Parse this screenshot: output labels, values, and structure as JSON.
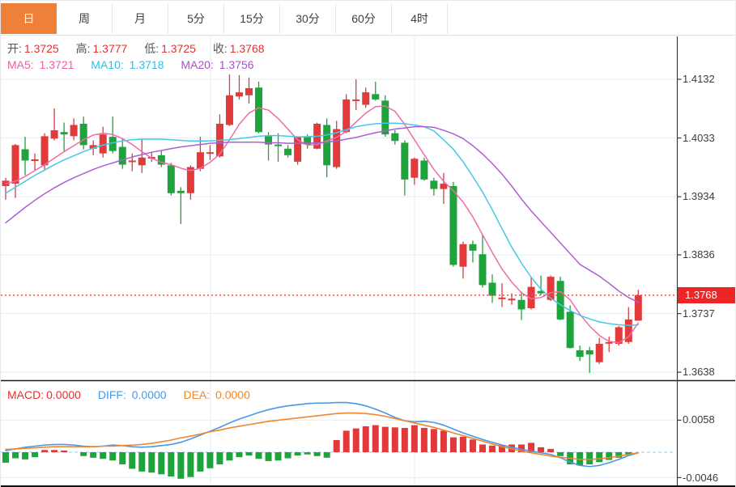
{
  "toolbar": {
    "tabs": [
      {
        "label": "日",
        "active": true
      },
      {
        "label": "周",
        "active": false
      },
      {
        "label": "月",
        "active": false
      },
      {
        "label": "5分",
        "active": false
      },
      {
        "label": "15分",
        "active": false
      },
      {
        "label": "30分",
        "active": false
      },
      {
        "label": "60分",
        "active": false
      },
      {
        "label": "4时",
        "active": false
      }
    ]
  },
  "legend": {
    "ohlc": [
      {
        "label": "开:",
        "value": "1.3725"
      },
      {
        "label": "高:",
        "value": "1.3777"
      },
      {
        "label": "低:",
        "value": "1.3725"
      },
      {
        "label": "收:",
        "value": "1.3768"
      }
    ],
    "ma": [
      {
        "label": "MA5:",
        "value": "1.3721"
      },
      {
        "label": "MA10:",
        "value": "1.3718"
      },
      {
        "label": "MA20:",
        "value": "1.3756"
      }
    ]
  },
  "macd_legend": [
    {
      "label": "MACD:",
      "value": "0.0000"
    },
    {
      "label": "DIFF:",
      "value": "0.0000"
    },
    {
      "label": "DEA:",
      "value": "0.0000"
    }
  ],
  "y_axis": {
    "ticks": [
      "1.4132",
      "1.4033",
      "1.3934",
      "1.3836",
      "1.3737",
      "1.3638"
    ],
    "current_price": "1.3768"
  },
  "macd_axis": {
    "ticks": [
      "0.0058",
      "-0.0046"
    ]
  },
  "colors": {
    "up": "#e23a3a",
    "down": "#1fa33c",
    "ma5": "#f06ca8",
    "ma10": "#45c8e9",
    "ma20": "#ad5fd5",
    "diff": "#4a97e8",
    "dea": "#f0862e",
    "price_line": "#f34b4b",
    "badge_bg": "#ef2525",
    "tab_active": "#ee8038",
    "grid": "#e4edf4",
    "zero_line": "#aad4f2",
    "axis_line": "#3a3a3a"
  },
  "chart_data": {
    "type": "candlestick",
    "title": "",
    "xlabel": "",
    "ylabel": "",
    "price_panel": {
      "y_ticks": [
        1.4132,
        1.4033,
        1.3934,
        1.3836,
        1.3737,
        1.3638
      ],
      "ylim": [
        1.36,
        1.418
      ],
      "current_price": 1.3768,
      "ohlc_latest": {
        "open": 1.3725,
        "high": 1.3777,
        "low": 1.3725,
        "close": 1.3768
      },
      "candles_ohlc": [
        [
          1.3952,
          1.3966,
          1.3929,
          1.3961
        ],
        [
          1.3956,
          1.4023,
          1.3932,
          1.4021
        ],
        [
          1.4014,
          1.4035,
          1.397,
          1.3995
        ],
        [
          1.3996,
          1.4007,
          1.3977,
          1.3997
        ],
        [
          1.3987,
          1.4041,
          1.398,
          1.4036
        ],
        [
          1.4032,
          1.4083,
          1.4029,
          1.4046
        ],
        [
          1.4043,
          1.4059,
          1.4011,
          1.4039
        ],
        [
          1.4036,
          1.4066,
          1.4029,
          1.4055
        ],
        [
          1.4057,
          1.4069,
          1.4014,
          1.4021
        ],
        [
          1.4015,
          1.4029,
          1.4004,
          1.4021
        ],
        [
          1.4007,
          1.4052,
          1.4,
          1.4039
        ],
        [
          1.4035,
          1.4069,
          1.4007,
          1.4011
        ],
        [
          1.4018,
          1.4032,
          1.3981,
          1.3988
        ],
        [
          1.3994,
          1.4007,
          1.3977,
          1.3995
        ],
        [
          1.3987,
          1.4032,
          1.3974,
          1.4
        ],
        [
          1.4,
          1.401,
          1.3993,
          1.4001
        ],
        [
          1.4004,
          1.4011,
          1.3984,
          1.3988
        ],
        [
          1.3987,
          1.3991,
          1.3936,
          1.394
        ],
        [
          1.3944,
          1.395,
          1.3888,
          1.394
        ],
        [
          1.394,
          1.3987,
          1.3929,
          1.3984
        ],
        [
          1.3981,
          1.4035,
          1.3977,
          1.4009
        ],
        [
          1.4008,
          1.4021,
          1.3996,
          1.4009
        ],
        [
          1.4002,
          1.4073,
          1.4,
          1.4057
        ],
        [
          1.4055,
          1.414,
          1.4053,
          1.4105
        ],
        [
          1.4103,
          1.4139,
          1.4098,
          1.411
        ],
        [
          1.4105,
          1.4135,
          1.4091,
          1.4117
        ],
        [
          1.4118,
          1.4128,
          1.4041,
          1.4043
        ],
        [
          1.4036,
          1.4043,
          1.3995,
          1.4022
        ],
        [
          1.4022,
          1.4041,
          1.3993,
          1.4021
        ],
        [
          1.4015,
          1.4021,
          1.4,
          1.4004
        ],
        [
          1.3993,
          1.4035,
          1.3988,
          1.4035
        ],
        [
          1.4036,
          1.4039,
          1.4015,
          1.4022
        ],
        [
          1.4015,
          1.4059,
          1.4014,
          1.4057
        ],
        [
          1.4055,
          1.4066,
          1.3967,
          1.3987
        ],
        [
          1.3984,
          1.4062,
          1.3981,
          1.4048
        ],
        [
          1.4043,
          1.4107,
          1.4041,
          1.4098
        ],
        [
          1.4097,
          1.4132,
          1.408,
          1.4098
        ],
        [
          1.4089,
          1.4118,
          1.4084,
          1.411
        ],
        [
          1.4107,
          1.4128,
          1.4096,
          1.4098
        ],
        [
          1.4096,
          1.4105,
          1.4035,
          1.4039
        ],
        [
          1.4041,
          1.4046,
          1.4022,
          1.4028
        ],
        [
          1.4025,
          1.4029,
          1.3936,
          1.3963
        ],
        [
          1.3966,
          1.4,
          1.3954,
          1.3998
        ],
        [
          1.3995,
          1.4,
          1.3961,
          1.3963
        ],
        [
          1.3961,
          1.3966,
          1.3936,
          1.3947
        ],
        [
          1.3947,
          1.3974,
          1.3922,
          1.3956
        ],
        [
          1.3952,
          1.3959,
          1.3816,
          1.3819
        ],
        [
          1.3816,
          1.3858,
          1.3796,
          1.3854
        ],
        [
          1.3854,
          1.386,
          1.3823,
          1.3843
        ],
        [
          1.3837,
          1.387,
          1.3781,
          1.3785
        ],
        [
          1.3789,
          1.3803,
          1.3755,
          1.3767
        ],
        [
          1.3763,
          1.3788,
          1.3748,
          1.3764
        ],
        [
          1.3761,
          1.3771,
          1.3752,
          1.3762
        ],
        [
          1.376,
          1.3774,
          1.3726,
          1.3744
        ],
        [
          1.3746,
          1.3799,
          1.3744,
          1.3782
        ],
        [
          1.3775,
          1.3801,
          1.3768,
          1.3771
        ],
        [
          1.376,
          1.3801,
          1.3758,
          1.3799
        ],
        [
          1.3792,
          1.3799,
          1.3726,
          1.3727
        ],
        [
          1.374,
          1.3751,
          1.3678,
          1.3679
        ],
        [
          1.3675,
          1.3683,
          1.3657,
          1.3664
        ],
        [
          1.3675,
          1.3681,
          1.3637,
          1.3668
        ],
        [
          1.3655,
          1.3696,
          1.3652,
          1.3686
        ],
        [
          1.3688,
          1.3698,
          1.3672,
          1.3689
        ],
        [
          1.3686,
          1.3716,
          1.3683,
          1.3714
        ],
        [
          1.3689,
          1.3748,
          1.3686,
          1.3727
        ],
        [
          1.3725,
          1.3777,
          1.3725,
          1.3768
        ]
      ],
      "ma5": [
        1.3956,
        1.396,
        1.3968,
        1.3978,
        1.3988,
        1.3999,
        1.401,
        1.402,
        1.403,
        1.4038,
        1.4041,
        1.4039,
        1.4032,
        1.4022,
        1.401,
        1.3999,
        1.3992,
        1.3988,
        1.3982,
        1.3978,
        1.3982,
        1.3992,
        1.4006,
        1.403,
        1.4056,
        1.4075,
        1.4084,
        1.408,
        1.4066,
        1.4048,
        1.403,
        1.4021,
        1.4022,
        1.4028,
        1.4034,
        1.4044,
        1.406,
        1.4075,
        1.4086,
        1.4087,
        1.4078,
        1.4056,
        1.403,
        1.4005,
        1.398,
        1.396,
        1.3944,
        1.3925,
        1.39,
        1.387,
        1.384,
        1.3812,
        1.379,
        1.3772,
        1.3762,
        1.3764,
        1.3772,
        1.3774,
        1.376,
        1.3736,
        1.3716,
        1.37,
        1.369,
        1.3688,
        1.3698,
        1.3721
      ],
      "ma10": [
        1.394,
        1.395,
        1.396,
        1.397,
        1.3979,
        1.3988,
        1.3996,
        1.4003,
        1.401,
        1.4016,
        1.4021,
        1.4025,
        1.4028,
        1.403,
        1.4031,
        1.4031,
        1.4031,
        1.403,
        1.4029,
        1.4028,
        1.4028,
        1.4028,
        1.4029,
        1.403,
        1.4032,
        1.4034,
        1.4036,
        1.4037,
        1.4037,
        1.4036,
        1.4035,
        1.4035,
        1.4036,
        1.4038,
        1.4042,
        1.4047,
        1.4052,
        1.4055,
        1.4057,
        1.4058,
        1.4058,
        1.4057,
        1.4055,
        1.4052,
        1.4045,
        1.403,
        1.4014,
        1.3993,
        1.3968,
        1.3942,
        1.3912,
        1.388,
        1.3849,
        1.3822,
        1.3798,
        1.3778,
        1.3763,
        1.3752,
        1.3742,
        1.3734,
        1.3728,
        1.3723,
        1.372,
        1.3718,
        1.3717,
        1.3718
      ],
      "ma20": [
        1.389,
        1.3903,
        1.3916,
        1.3928,
        1.3939,
        1.3949,
        1.3958,
        1.3966,
        1.3973,
        1.398,
        1.3986,
        1.3991,
        1.3996,
        1.4001,
        1.4005,
        1.4009,
        1.4012,
        1.4015,
        1.4018,
        1.402,
        1.4022,
        1.4024,
        1.4025,
        1.4026,
        1.4026,
        1.4026,
        1.4026,
        1.4025,
        1.4025,
        1.4024,
        1.4024,
        1.4024,
        1.4025,
        1.4026,
        1.4028,
        1.4031,
        1.4034,
        1.4038,
        1.4042,
        1.4045,
        1.4048,
        1.405,
        1.4052,
        1.4052,
        1.4051,
        1.4046,
        1.404,
        1.4032,
        1.402,
        1.4006,
        1.399,
        1.3972,
        1.3952,
        1.393,
        1.391,
        1.3892,
        1.3874,
        1.3856,
        1.3838,
        1.382,
        1.381,
        1.38,
        1.3788,
        1.3775,
        1.3764,
        1.3756
      ]
    },
    "macd_panel": {
      "y_ticks": [
        0.0058,
        -0.0046
      ],
      "latest": {
        "macd": 0.0,
        "diff": 0.0,
        "dea": 0.0
      },
      "histogram": [
        -0.0019,
        -0.0011,
        -0.0013,
        -0.0009,
        0.0004,
        0.0004,
        0.0003,
        0.0,
        -0.0007,
        -0.001,
        -0.0012,
        -0.0015,
        -0.0022,
        -0.003,
        -0.0035,
        -0.0037,
        -0.004,
        -0.0044,
        -0.0048,
        -0.0045,
        -0.0035,
        -0.0029,
        -0.0022,
        -0.0015,
        -0.0009,
        -0.0006,
        -0.0012,
        -0.0016,
        -0.0015,
        -0.0011,
        -0.0006,
        -0.0004,
        -0.0007,
        -0.001,
        0.0022,
        0.0039,
        0.0043,
        0.0047,
        0.0049,
        0.0046,
        0.0045,
        0.0044,
        0.0049,
        0.0044,
        0.0042,
        0.0039,
        0.0027,
        0.0028,
        0.0023,
        0.0014,
        0.0012,
        0.0013,
        0.0014,
        0.0014,
        0.0017,
        0.0009,
        0.0006,
        -0.0007,
        -0.0022,
        -0.0024,
        -0.0022,
        -0.0018,
        -0.0014,
        -0.001,
        -0.0005,
        0.0
      ],
      "diff": [
        0.0003,
        0.0006,
        0.0009,
        0.0011,
        0.0013,
        0.0014,
        0.0014,
        0.0013,
        0.0011,
        0.001,
        0.0011,
        0.0013,
        0.0012,
        0.001,
        0.0009,
        0.001,
        0.0012,
        0.0014,
        0.0018,
        0.0024,
        0.0031,
        0.0038,
        0.0045,
        0.0053,
        0.006,
        0.0066,
        0.0072,
        0.0077,
        0.0081,
        0.0084,
        0.0086,
        0.0088,
        0.0089,
        0.0089,
        0.009,
        0.009,
        0.0088,
        0.0084,
        0.0078,
        0.0071,
        0.0063,
        0.0057,
        0.0055,
        0.0056,
        0.0054,
        0.0049,
        0.0042,
        0.0035,
        0.0029,
        0.0023,
        0.0018,
        0.0013,
        0.0009,
        0.0005,
        0.0002,
        -0.0001,
        -0.0004,
        -0.001,
        -0.0018,
        -0.0024,
        -0.0026,
        -0.0024,
        -0.0019,
        -0.0013,
        -0.0006,
        -0.0001
      ],
      "dea": [
        0.0005,
        0.0006,
        0.0007,
        0.0008,
        0.0009,
        0.001,
        0.001,
        0.001,
        0.001,
        0.001,
        0.0011,
        0.0011,
        0.0012,
        0.0013,
        0.0014,
        0.0016,
        0.0019,
        0.0022,
        0.0026,
        0.0029,
        0.0033,
        0.0037,
        0.004,
        0.0044,
        0.0047,
        0.005,
        0.0053,
        0.0056,
        0.0058,
        0.006,
        0.0062,
        0.0064,
        0.0066,
        0.0068,
        0.007,
        0.0071,
        0.0071,
        0.007,
        0.0068,
        0.0065,
        0.0061,
        0.0057,
        0.0053,
        0.0049,
        0.0045,
        0.004,
        0.0035,
        0.003,
        0.0025,
        0.002,
        0.0015,
        0.001,
        0.0006,
        0.0002,
        -0.0001,
        -0.0004,
        -0.0007,
        -0.0009,
        -0.0011,
        -0.0013,
        -0.0013,
        -0.0012,
        -0.001,
        -0.0007,
        -0.0004,
        -0.0001
      ]
    }
  }
}
